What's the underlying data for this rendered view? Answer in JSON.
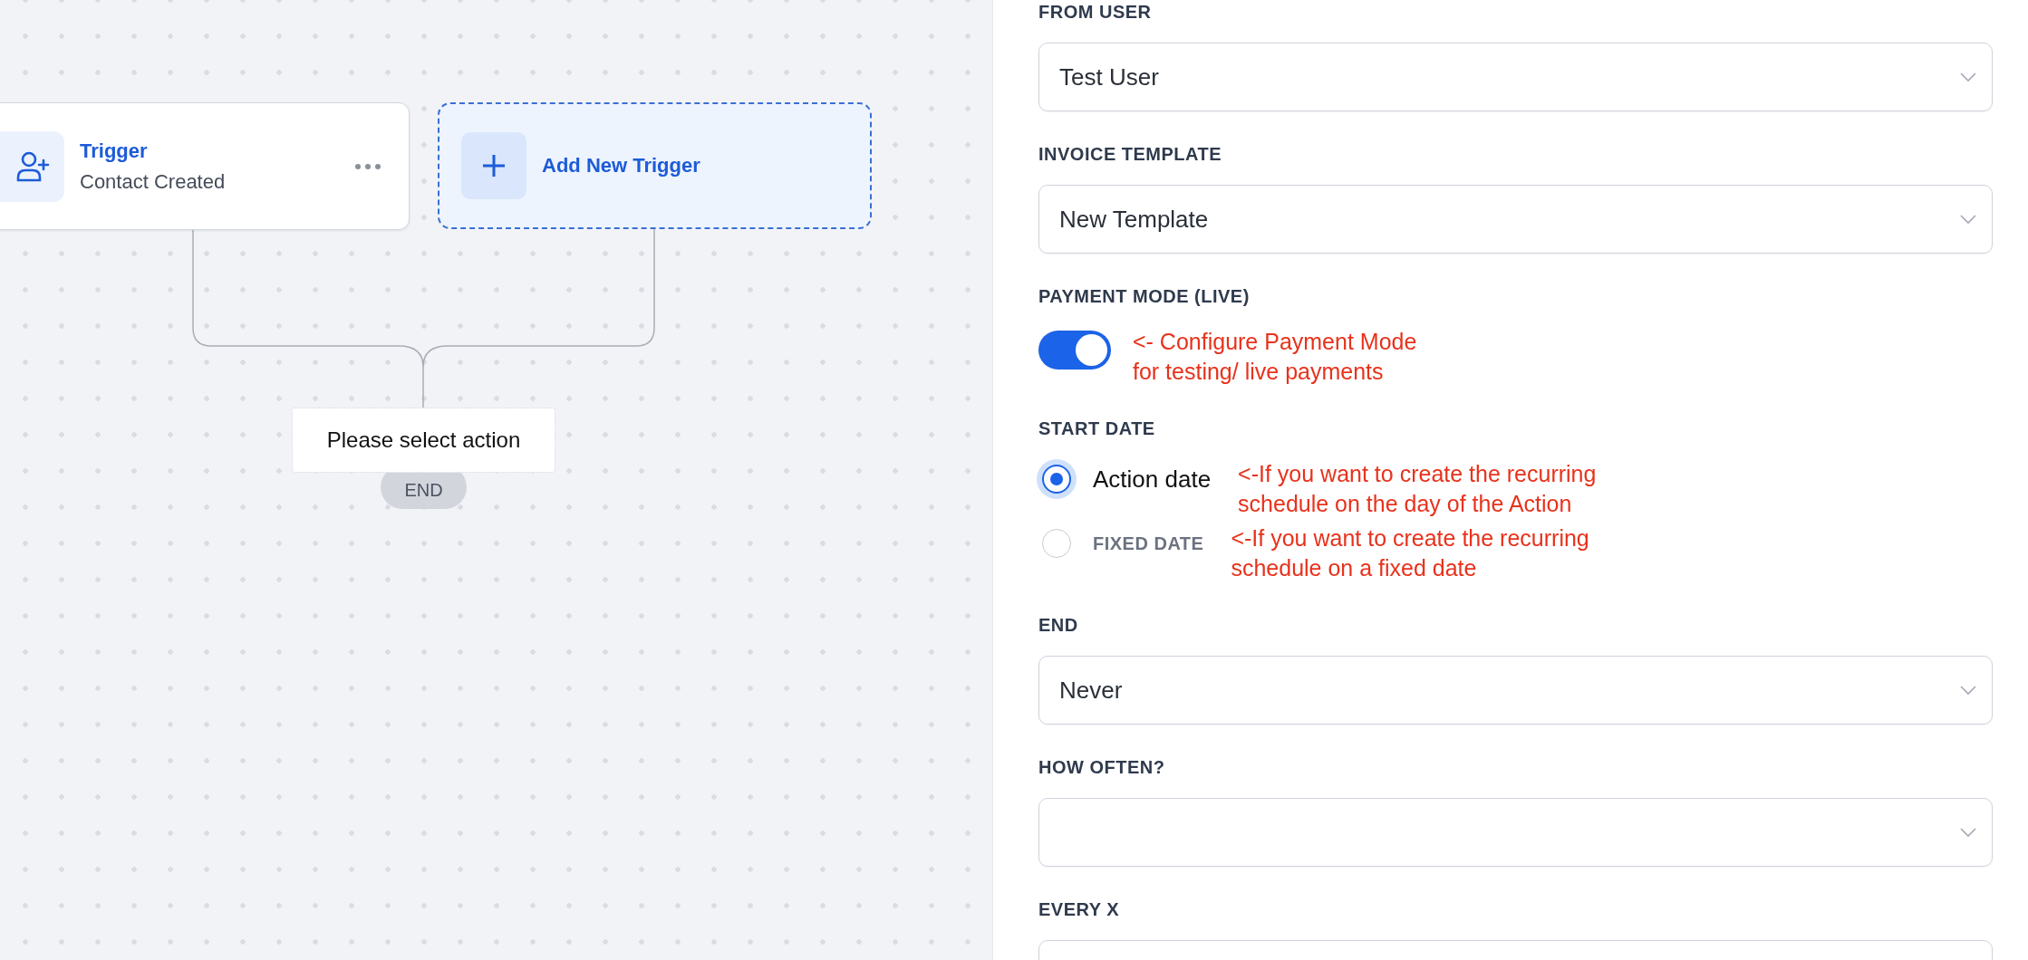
{
  "canvas": {
    "trigger_node": {
      "title": "Trigger",
      "subtitle": "Contact Created"
    },
    "add_trigger": {
      "label": "Add New Trigger"
    },
    "action_placeholder": "Please select action",
    "end_label": "END"
  },
  "form": {
    "fields": [
      {
        "kind": "select",
        "label": "FROM USER",
        "value": "Test User"
      },
      {
        "kind": "select",
        "label": "INVOICE TEMPLATE",
        "value": "New Template"
      },
      {
        "kind": "toggle",
        "label": "PAYMENT MODE (LIVE)",
        "on": true,
        "note": "<- Configure Payment Mode\nfor testing/ live payments"
      },
      {
        "kind": "radio",
        "label": "START DATE",
        "options": [
          {
            "label": "Action date",
            "selected": true,
            "note": "<-If you want to create the recurring\nschedule on the day of the  Action"
          },
          {
            "label": "FIXED DATE",
            "selected": false,
            "note": "<-If you want to create the recurring\nschedule on a fixed date"
          }
        ]
      },
      {
        "kind": "select",
        "label": "END",
        "value": "Never"
      },
      {
        "kind": "select",
        "label": "HOW OFTEN?"
      },
      {
        "kind": "select",
        "label": "EVERY X"
      }
    ]
  }
}
